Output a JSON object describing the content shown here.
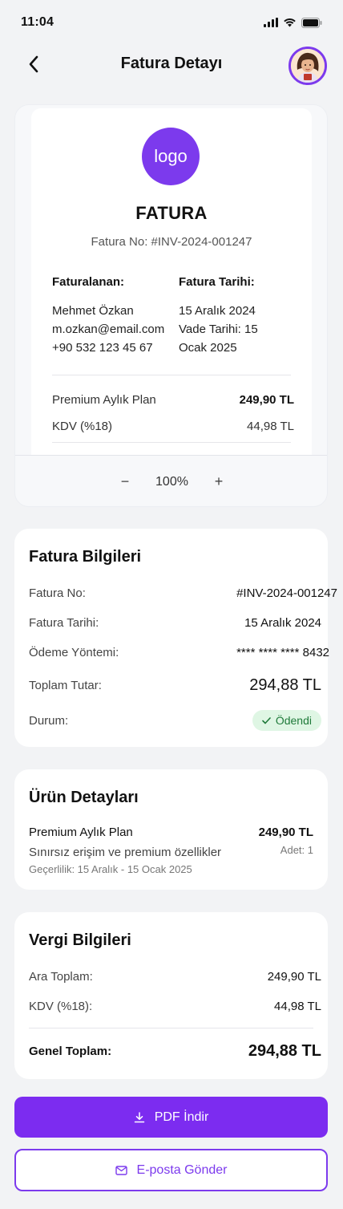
{
  "status": {
    "time": "11:04"
  },
  "header": {
    "title": "Fatura Detayı"
  },
  "invoice_preview": {
    "logo_text": "logo",
    "title": "FATURA",
    "number": "Fatura No: #INV-2024-001247",
    "billed_to_label": "Faturalanan:",
    "billed_to_name": "Mehmet Özkan",
    "billed_to_email": "m.ozkan@email.com",
    "billed_to_phone": "+90 532 123 45 67",
    "date_label": "Fatura Tarihi:",
    "date_line1": "15 Aralık 2024",
    "date_line2": "Vade Tarihi: 15",
    "date_line3": "Ocak 2025",
    "item1_name": "Premium Aylık Plan",
    "item1_price": "249,90 TL",
    "item2_name": "KDV (%18)",
    "item2_price": "44,98 TL",
    "zoom_minus": "−",
    "zoom_level": "100%",
    "zoom_plus": "+"
  },
  "invoice_info": {
    "title": "Fatura Bilgileri",
    "rows": [
      {
        "label": "Fatura No:",
        "value": "#INV-2024-001247"
      },
      {
        "label": "Fatura Tarihi:",
        "value": "15 Aralık 2024"
      },
      {
        "label": "Ödeme Yöntemi:",
        "value": "**** **** **** 8432"
      },
      {
        "label": "Toplam Tutar:",
        "value": "294,88 TL"
      },
      {
        "label": "Durum:",
        "value": "Ödendi"
      }
    ]
  },
  "product_details": {
    "title": "Ürün Detayları",
    "name": "Premium Aylık Plan",
    "price": "249,90 TL",
    "description": "Sınırsız erişim ve premium özellikler",
    "quantity": "Adet: 1",
    "validity": "Geçerlilik: 15 Aralık - 15 Ocak 2025"
  },
  "tax_info": {
    "title": "Vergi Bilgileri",
    "subtotal_label": "Ara Toplam:",
    "subtotal_value": "249,90 TL",
    "vat_label": "KDV (%18):",
    "vat_value": "44,98 TL",
    "grand_total_label": "Genel Toplam:",
    "grand_total_value": "294,88 TL"
  },
  "actions": {
    "pdf_label": "PDF İndir",
    "email_label": "E-posta Gönder"
  },
  "colors": {
    "accent": "#7c3aed",
    "success_bg": "#dff6e4",
    "success_text": "#1f7a3a"
  }
}
